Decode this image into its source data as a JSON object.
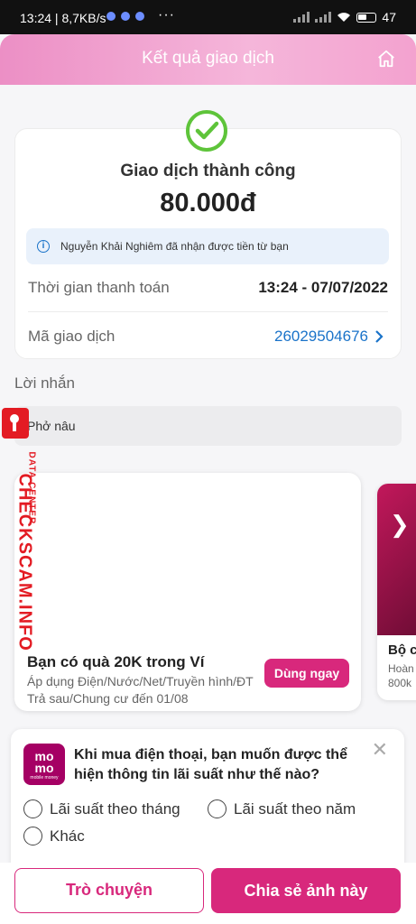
{
  "status_bar": {
    "time_speed": "13:24 | 8,7KB/s",
    "more": "···",
    "battery": "47"
  },
  "header": {
    "title": "Kết quả giao dịch",
    "home_icon": "home-icon"
  },
  "result": {
    "status": "Giao dịch thành công",
    "amount": "80.000đ",
    "info": "Nguyễn Khải Nghiêm đã nhận được tiền từ bạn",
    "time_label": "Thời gian thanh toán",
    "time_value": "13:24 - 07/07/2022",
    "id_label": "Mã giao dịch",
    "id_value": "26029504676",
    "id_color": "#1a73c9",
    "success_color": "#5ec43a"
  },
  "note": {
    "label": "Lời nhắn",
    "text": "Phở nâu"
  },
  "watermark": {
    "line1": "CHECKSCAM.INFO",
    "line2": "DATA CENTER",
    "color": "#e31b23"
  },
  "promo": {
    "title": "Bạn có quà 20K trong Ví",
    "desc": "Áp dụng Điện/Nước/Net/Truyền hình/ĐT Trả sau/Chung cư đến 01/08",
    "button": "Dùng ngay",
    "accent": "#d8287c"
  },
  "promo2": {
    "title": "Bộ c",
    "line1": "Hoàn",
    "line2": "800k"
  },
  "survey": {
    "logo_top": "mo",
    "logo_bottom": "mo",
    "logo_small": "mobile money",
    "question": "Khi mua điện thoại, bạn muốn được thể hiện thông tin lãi suất như thế nào?",
    "options": [
      "Lãi suất theo tháng",
      "Lãi suất theo năm",
      "Khác"
    ]
  },
  "actions": {
    "chat": "Trò chuyện",
    "share": "Chia sẻ ảnh này"
  }
}
